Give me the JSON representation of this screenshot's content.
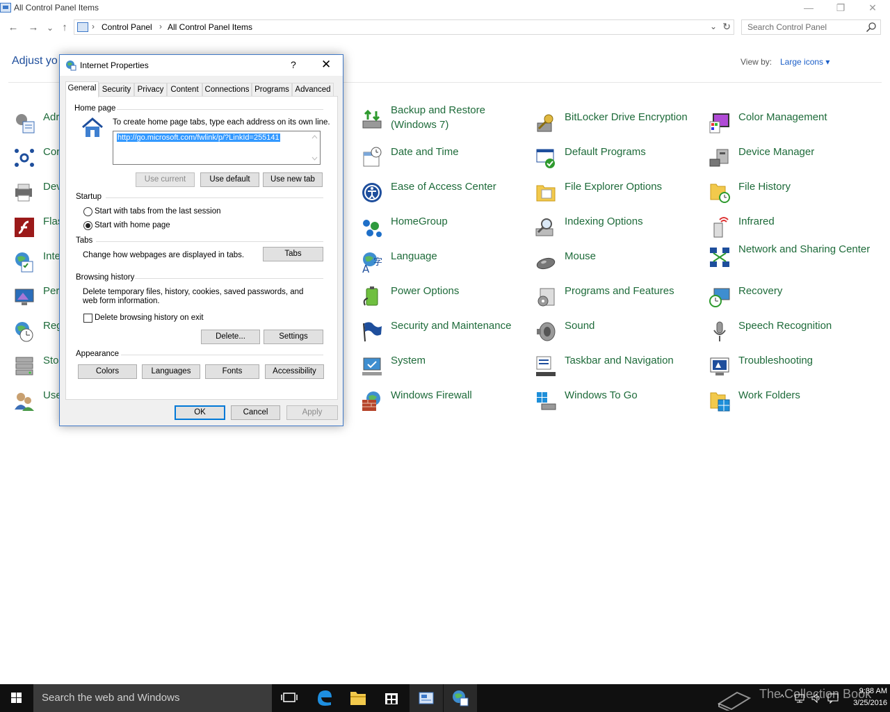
{
  "window": {
    "title": "All Control Panel Items",
    "minimize": "—",
    "restore": "❐",
    "close": "✕"
  },
  "nav": {
    "back": "←",
    "forward": "→",
    "recent": "⌄",
    "up": "↑",
    "breadcrumbs": [
      "Control Panel",
      "All Control Panel Items"
    ],
    "separator": "›",
    "dropdown": "⌄",
    "refresh": "↻",
    "search_placeholder": "Search Control Panel"
  },
  "main": {
    "heading": "Adjust yo",
    "view_by_label": "View by:",
    "view_by_value": "Large icons ▾"
  },
  "items": [
    {
      "label": "Adr",
      "icon": "administrative-tools-icon"
    },
    {
      "label": "Cor",
      "icon": "color-gear-icon"
    },
    {
      "label": "Dev",
      "icon": "devices-printers-icon"
    },
    {
      "label": "Flas",
      "icon": "flash-player-icon"
    },
    {
      "label": "Inte",
      "icon": "internet-options-icon"
    },
    {
      "label": "Per",
      "icon": "personalization-icon"
    },
    {
      "label": "Reg",
      "icon": "region-icon"
    },
    {
      "label": "Sto",
      "icon": "storage-spaces-icon"
    },
    {
      "label": "Use",
      "icon": "user-accounts-icon"
    },
    {
      "label": "Backup and Restore (Windows 7)",
      "icon": "backup-restore-icon"
    },
    {
      "label": "Date and Time",
      "icon": "date-time-icon"
    },
    {
      "label": "Ease of Access Center",
      "icon": "ease-of-access-icon"
    },
    {
      "label": "HomeGroup",
      "icon": "homegroup-icon"
    },
    {
      "label": "Language",
      "icon": "language-icon"
    },
    {
      "label": "Power Options",
      "icon": "power-options-icon"
    },
    {
      "label": "Security and Maintenance",
      "icon": "security-flag-icon"
    },
    {
      "label": "System",
      "icon": "system-icon"
    },
    {
      "label": "Windows Firewall",
      "icon": "firewall-icon"
    },
    {
      "label": "BitLocker Drive Encryption",
      "icon": "bitlocker-icon"
    },
    {
      "label": "Default Programs",
      "icon": "default-programs-icon"
    },
    {
      "label": "File Explorer Options",
      "icon": "folder-options-icon"
    },
    {
      "label": "Indexing Options",
      "icon": "indexing-icon"
    },
    {
      "label": "Mouse",
      "icon": "mouse-icon"
    },
    {
      "label": "Programs and Features",
      "icon": "programs-features-icon"
    },
    {
      "label": "Sound",
      "icon": "sound-icon"
    },
    {
      "label": "Taskbar and Navigation",
      "icon": "taskbar-icon"
    },
    {
      "label": "Windows To Go",
      "icon": "windows-to-go-icon"
    },
    {
      "label": "Color Management",
      "icon": "color-management-icon"
    },
    {
      "label": "Device Manager",
      "icon": "device-manager-icon"
    },
    {
      "label": "File History",
      "icon": "file-history-icon"
    },
    {
      "label": "Infrared",
      "icon": "infrared-icon"
    },
    {
      "label": "Network and Sharing Center",
      "icon": "network-sharing-icon"
    },
    {
      "label": "Recovery",
      "icon": "recovery-icon"
    },
    {
      "label": "Speech Recognition",
      "icon": "microphone-icon"
    },
    {
      "label": "Troubleshooting",
      "icon": "troubleshooting-icon"
    },
    {
      "label": "Work Folders",
      "icon": "work-folders-icon"
    }
  ],
  "dialog": {
    "title": "Internet Properties",
    "help": "?",
    "close": "✕",
    "tabs": [
      "General",
      "Security",
      "Privacy",
      "Content",
      "Connections",
      "Programs",
      "Advanced"
    ],
    "active_tab": "General",
    "home_page": {
      "group": "Home page",
      "instructions": "To create home page tabs, type each address on its own line.",
      "url": "http://go.microsoft.com/fwlink/p/?LinkId=255141",
      "use_current": "Use current",
      "use_default": "Use default",
      "use_new_tab": "Use new tab"
    },
    "startup": {
      "group": "Startup",
      "option_last_session": "Start with tabs from the last session",
      "option_home_page": "Start with home page",
      "selected": "Start with home page"
    },
    "tabs_group": {
      "group": "Tabs",
      "description": "Change how webpages are displayed in tabs.",
      "button": "Tabs"
    },
    "browsing_history": {
      "group": "Browsing history",
      "description": "Delete temporary files, history, cookies, saved passwords, and web form information.",
      "delete_on_exit": "Delete browsing history on exit",
      "delete_on_exit_checked": false,
      "delete": "Delete...",
      "settings": "Settings"
    },
    "appearance": {
      "group": "Appearance",
      "colors": "Colors",
      "languages": "Languages",
      "fonts": "Fonts",
      "accessibility": "Accessibility"
    },
    "ok": "OK",
    "cancel": "Cancel",
    "apply": "Apply"
  },
  "taskbar": {
    "search_placeholder": "Search the web and Windows",
    "watermark": "The Collection Book",
    "time": "9:38 AM",
    "date": "3/25/2016",
    "tray_chevron": "^"
  },
  "colors": {
    "link_green": "#1e6b3a",
    "heading_blue": "#1e4e9c",
    "accent_blue": "#0078d7",
    "taskbar": "#101010"
  }
}
